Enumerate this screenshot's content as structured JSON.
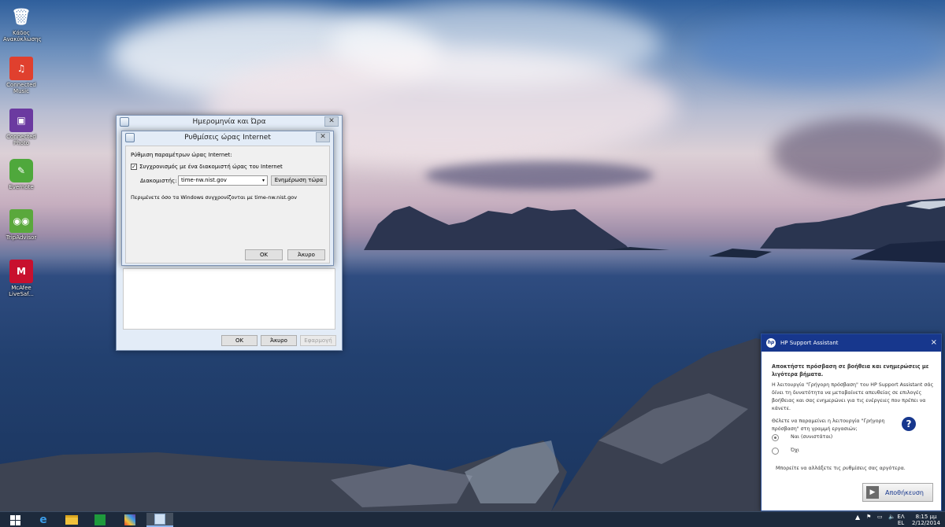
{
  "desktop": {
    "icons": [
      {
        "name": "recycle-bin",
        "icon": "trash-icon",
        "label": "Κάδος Ανακύκλωσης",
        "color": "#5b7fa8"
      },
      {
        "name": "connected-music",
        "icon": "music-icon",
        "label": "Connected Music",
        "color": "#e0402e"
      },
      {
        "name": "connected-photo",
        "icon": "photo-icon",
        "label": "Connected Photo",
        "color": "#6b3aa0"
      },
      {
        "name": "evernote",
        "icon": "elephant-icon",
        "label": "Evernote",
        "color": "#4fa83c"
      },
      {
        "name": "tripadvisor",
        "icon": "owl-icon",
        "label": "TripAdvisor",
        "color": "#5aa83c"
      },
      {
        "name": "mcafee",
        "icon": "shield-icon",
        "label": "McAfee LiveSaf...",
        "color": "#c8102e"
      }
    ]
  },
  "datetime_dialog": {
    "title": "Ημερομηνία και Ώρα",
    "ok": "OK",
    "cancel": "Άκυρο",
    "apply": "Εφαρμογή"
  },
  "internet_time_dialog": {
    "title": "Ρυθμίσεις ώρας Internet",
    "section_label": "Ρύθμιση παραμέτρων ώρας Internet:",
    "sync_checkbox_label": "Συγχρονισμός με ένα διακομιστή ώρας του Internet",
    "sync_checked": true,
    "server_label": "Διακομιστής:",
    "server_value": "time-nw.nist.gov",
    "update_now": "Ενημέρωση τώρα",
    "status_text": "Περιμένετε όσο τα Windows συγχρονίζονται με time-nw.nist.gov",
    "ok": "OK",
    "cancel": "Άκυρο"
  },
  "hp_popup": {
    "title": "HP Support Assistant",
    "logo_text": "hp",
    "headline": "Αποκτήστε πρόσβαση σε βοήθεια και ενημερώσεις με λιγότερα βήματα.",
    "body": "Η λειτουργία \"Γρήγορη πρόσβαση\" του HP Support Assistant σάς δίνει τη δυνατότητα να μεταβαίνετε απευθείας σε επιλογές βοήθειας και σας ενημερώνει για τις ενέργειες που πρέπει να κάνετε.",
    "question": "Θέλετε να παραμείνει η λειτουργία \"Γρήγορη πρόσβαση\" στη γραμμή εργασιών;",
    "option_yes": "Ναι (συνιστάται)",
    "option_no": "Όχι",
    "selected": "yes",
    "footer_note": "Μπορείτε να αλλάξετε τις ρυθμίσεις σας αργότερα.",
    "save_button": "Αποθήκευση"
  },
  "taskbar": {
    "language": "ΕΛ",
    "language_sub": "EL",
    "time": "8:15 μμ",
    "date": "2/12/2014"
  }
}
